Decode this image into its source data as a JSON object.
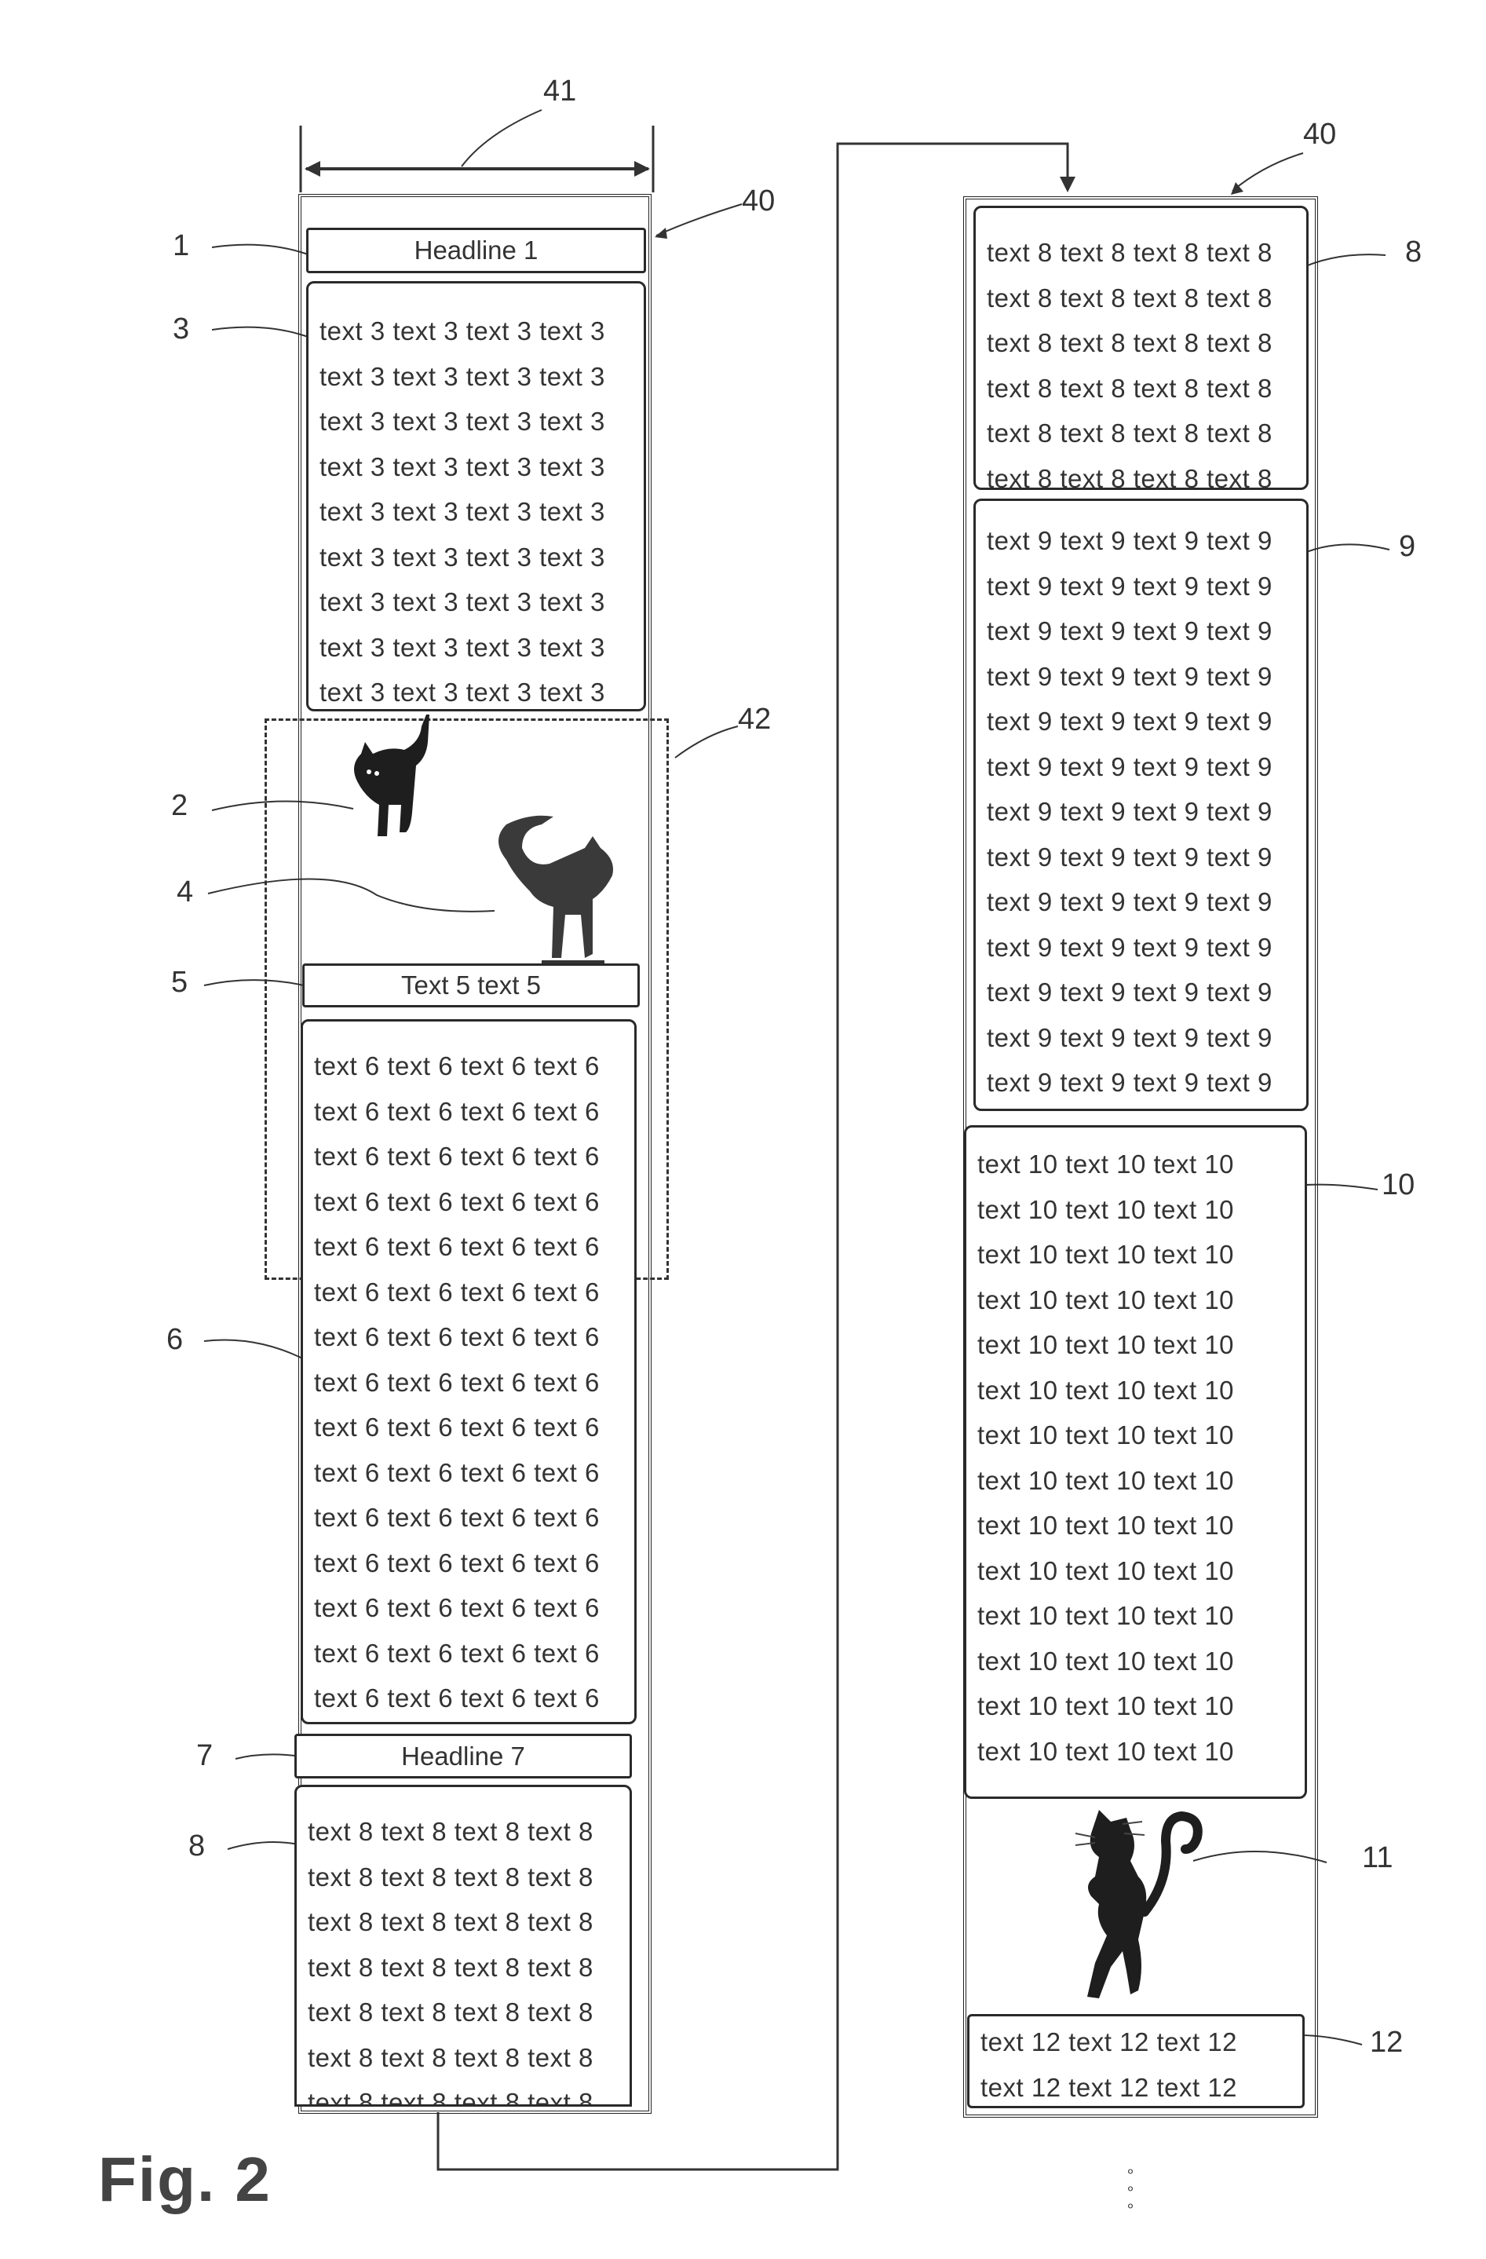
{
  "figure": {
    "caption": "Fig. 2",
    "continuation_marker": "∘\n∘\n∘"
  },
  "reference_labels": {
    "width_dimension": "41",
    "column_frame_left": "40",
    "column_frame_right": "40",
    "dashed_region": "42",
    "headline_1": "1",
    "text_3": "3",
    "image_2": "2",
    "image_4": "4",
    "text_5": "5",
    "text_6": "6",
    "headline_7": "7",
    "text_8_left": "8",
    "text_8_right": "8",
    "text_9": "9",
    "text_10": "10",
    "image_11": "11",
    "text_12": "12"
  },
  "left_column": {
    "headline_1": "Headline 1",
    "text_3_lines": [
      "text 3 text 3 text 3 text 3",
      "text 3 text 3 text 3 text 3",
      "text 3 text 3 text 3 text 3",
      "text 3 text 3 text 3 text 3",
      "text 3 text 3 text 3 text 3",
      "text 3 text 3 text 3 text 3",
      "text 3 text 3 text 3 text 3",
      "text 3 text 3 text 3 text 3",
      "text 3 text 3 text 3 text 3"
    ],
    "image_2": "cat-silhouette-small",
    "image_4": "cat-silhouette-large",
    "text_5": "Text 5 text 5",
    "text_6_lines": [
      "text 6 text 6 text 6 text 6",
      "text 6 text 6 text 6 text 6",
      "text 6 text 6 text 6 text 6",
      "text 6 text 6 text 6 text 6",
      "text 6 text 6 text 6 text 6",
      "text 6 text 6 text 6 text 6",
      "text 6 text 6 text 6 text 6",
      "text 6 text 6 text 6 text 6",
      "text 6 text 6 text 6 text 6",
      "text 6 text 6 text 6 text 6",
      "text 6 text 6 text 6 text 6",
      "text 6 text 6 text 6 text 6",
      "text 6 text 6 text 6 text 6",
      "text 6 text 6 text 6 text 6",
      "text 6 text 6 text 6 text 6"
    ],
    "headline_7": "Headline 7",
    "text_8_lines": [
      "text 8 text 8 text 8 text 8",
      "text 8 text 8 text 8 text 8",
      "text 8 text 8 text 8 text 8",
      "text 8 text 8 text 8 text 8",
      "text 8 text 8 text 8 text 8",
      "text 8 text 8 text 8 text 8",
      "text 8 text 8 text 8 text 8"
    ]
  },
  "right_column": {
    "text_8_lines": [
      "text 8 text 8 text 8 text 8",
      "text 8 text 8 text 8 text 8",
      "text 8 text 8 text 8 text 8",
      "text 8 text 8 text 8 text 8",
      "text 8 text 8 text 8 text 8",
      "text 8 text 8 text 8 text 8"
    ],
    "text_9_lines": [
      "text 9 text 9 text 9 text 9",
      "text 9 text 9 text 9 text 9",
      "text 9 text 9 text 9 text 9",
      "text 9 text 9 text 9 text 9",
      "text 9 text 9 text 9 text 9",
      "text 9 text 9 text 9 text 9",
      "text 9 text 9 text 9 text 9",
      "text 9 text 9 text 9 text 9",
      "text 9 text 9 text 9 text 9",
      "text 9 text 9 text 9 text 9",
      "text 9 text 9 text 9 text 9",
      "text 9 text 9 text 9 text 9",
      "text 9 text 9 text 9 text 9"
    ],
    "text_10_lines": [
      "text 10 text 10 text 10",
      "text 10 text 10 text 10",
      "text 10 text 10 text 10",
      "text 10 text 10 text 10",
      "text 10 text 10 text 10",
      "text 10 text 10 text 10",
      "text 10 text 10 text 10",
      "text 10 text 10 text 10",
      "text 10 text 10 text 10",
      "text 10 text 10 text 10",
      "text 10 text 10 text 10",
      "text 10 text 10 text 10",
      "text 10 text 10 text 10",
      "text 10 text 10 text 10"
    ],
    "image_11": "monkey-silhouette",
    "text_12_lines": [
      "text 12 text 12 text 12",
      "text 12 text 12 text 12"
    ]
  }
}
